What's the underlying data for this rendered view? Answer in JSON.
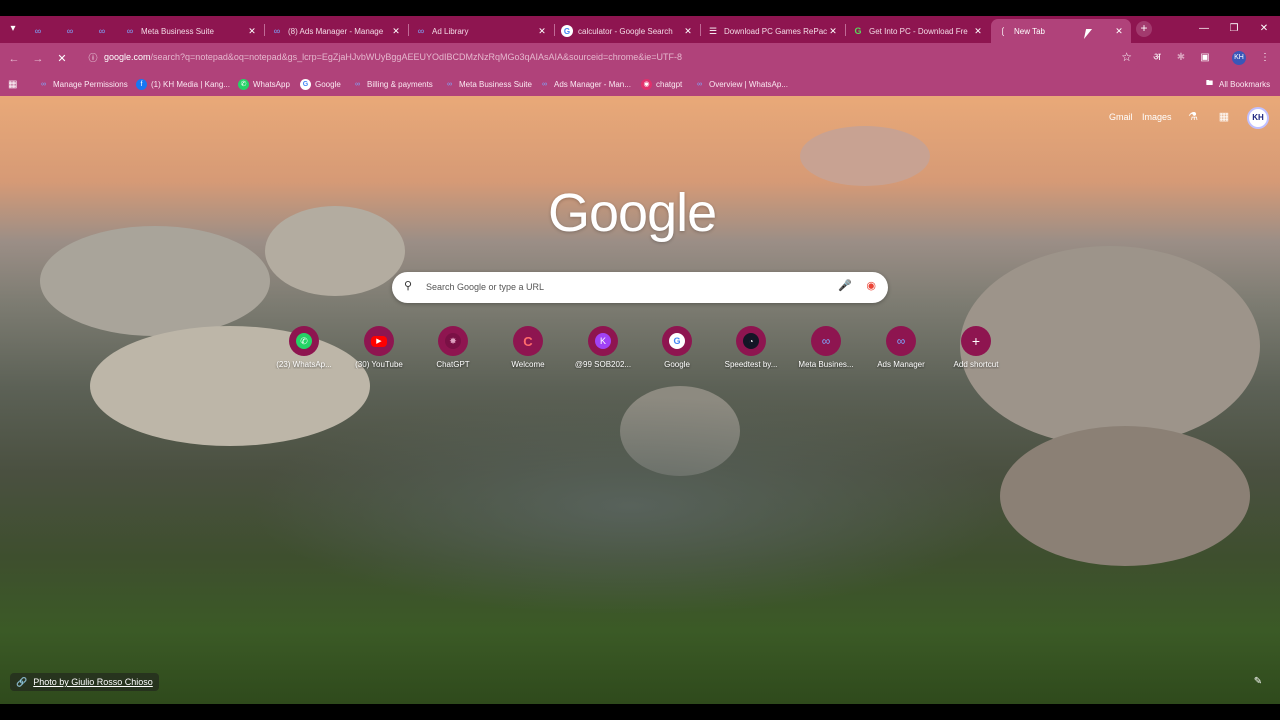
{
  "tabs": [
    {
      "label": "",
      "icon": "meta-icon"
    },
    {
      "label": "",
      "icon": "meta-icon"
    },
    {
      "label": "",
      "icon": "meta-icon"
    },
    {
      "label": "Meta Business Suite",
      "icon": "meta-icon"
    },
    {
      "label": "(8) Ads Manager - Manage",
      "icon": "meta-icon"
    },
    {
      "label": "Ad Library",
      "icon": "meta-icon"
    },
    {
      "label": "calculator - Google Search",
      "icon": "google-icon"
    },
    {
      "label": "Download PC Games RePac",
      "icon": "doc-icon"
    },
    {
      "label": "Get Into PC - Download Fre",
      "icon": "getintopc-icon"
    },
    {
      "label": "New Tab",
      "icon": "loading-icon"
    }
  ],
  "toolbar": {
    "url_host": "google.com",
    "url_rest": "/search?q=notepad&oq=notepad&gs_lcrp=EgZjaHJvbWUyBggAEEUYOdIBCDMzNzRqMGo3qAIAsAIA&sourceid=chrome&ie=UTF-8"
  },
  "bookmarks": [
    {
      "label": "Manage Permissions",
      "icon": "meta-icon"
    },
    {
      "label": "(1) KH Media | Kang...",
      "icon": "facebook-icon"
    },
    {
      "label": "WhatsApp",
      "icon": "whatsapp-icon"
    },
    {
      "label": "Google",
      "icon": "google-icon"
    },
    {
      "label": "Billing & payments",
      "icon": "meta-icon"
    },
    {
      "label": "Meta Business Suite",
      "icon": "meta-icon"
    },
    {
      "label": "Ads Manager - Man...",
      "icon": "meta-icon"
    },
    {
      "label": "chatgpt",
      "icon": "instagram-icon"
    },
    {
      "label": "Overview | WhatsAp...",
      "icon": "meta-icon"
    }
  ],
  "all_bookmarks": "All Bookmarks",
  "header": {
    "gmail": "Gmail",
    "images": "Images",
    "avatar": "KH"
  },
  "logo": "Google",
  "search": {
    "placeholder": "Search Google or type a URL"
  },
  "shortcuts": [
    {
      "label": "(23) WhatsAp...",
      "icon": "whatsapp-icon",
      "color": "#25d366"
    },
    {
      "label": "(30) YouTube",
      "icon": "youtube-icon",
      "color": "#ff0000"
    },
    {
      "label": "ChatGPT",
      "icon": "chatgpt-icon",
      "color": "#7a1045"
    },
    {
      "label": "Welcome",
      "icon": "welcome-icon",
      "color": "#ff6b6b"
    },
    {
      "label": "@99 SOB202...",
      "icon": "k-icon",
      "color": "#a142f4"
    },
    {
      "label": "Google",
      "icon": "google-icon",
      "color": "#ffffff"
    },
    {
      "label": "Speedtest by...",
      "icon": "speedtest-icon",
      "color": "#141526"
    },
    {
      "label": "Meta Busines...",
      "icon": "meta-icon",
      "color": "#0866ff"
    },
    {
      "label": "Ads Manager",
      "icon": "meta-icon",
      "color": "#0866ff"
    },
    {
      "label": "Add shortcut",
      "icon": "plus-icon",
      "color": "#8e1550"
    }
  ],
  "photo_credit": "Photo by Giulio Rosso Chioso",
  "colors": {
    "frame": "#8e1550",
    "toolbar": "#b0427a"
  }
}
